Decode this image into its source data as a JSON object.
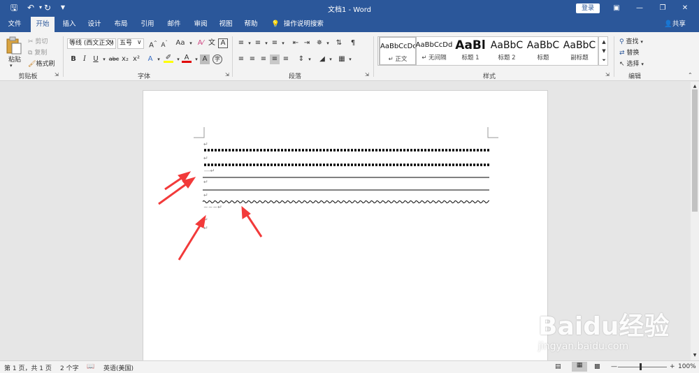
{
  "titlebar": {
    "doc_title": "文档1 - Word",
    "login_label": "登录",
    "quick_access": [
      "save-icon",
      "undo-icon",
      "redo-icon",
      "customize-icon"
    ]
  },
  "tabs": [
    "文件",
    "开始",
    "插入",
    "设计",
    "布局",
    "引用",
    "邮件",
    "审阅",
    "视图",
    "帮助"
  ],
  "active_tab": "开始",
  "tell_me": "操作说明搜索",
  "share_label": "共享",
  "clipboard": {
    "paste": "粘贴",
    "cut": "剪切",
    "copy": "复制",
    "format_painter": "格式刷",
    "group_label": "剪贴板"
  },
  "font": {
    "font_name": "等线 (西文正文)",
    "font_size": "五号",
    "change_case": "Aa",
    "bold": "B",
    "italic": "I",
    "underline": "U",
    "strikethrough": "abc",
    "subscript": "x₂",
    "superscript": "x²",
    "group_label": "字体"
  },
  "paragraph": {
    "group_label": "段落"
  },
  "styles": {
    "items": [
      {
        "preview": "AaBbCcDd",
        "label": "↵ 正文"
      },
      {
        "preview": "AaBbCcDd",
        "label": "↵ 无间隔"
      },
      {
        "preview": "AaBl",
        "label": "标题 1"
      },
      {
        "preview": "AaBbC",
        "label": "标题 2"
      },
      {
        "preview": "AaBbC",
        "label": "标题"
      },
      {
        "preview": "AaBbC",
        "label": "副标题"
      }
    ],
    "group_label": "样式"
  },
  "editing": {
    "find": "查找",
    "replace": "替换",
    "select": "选择",
    "group_label": "编辑"
  },
  "document": {
    "paragraph_mark": "↵",
    "dash_text": "---",
    "tilde_text": "~~~"
  },
  "statusbar": {
    "page_info": "第 1 页，共 1 页",
    "word_count": "2 个字",
    "language": "英语(美国)",
    "zoom": "100%"
  },
  "watermark": {
    "title": "Baidu经验",
    "url": "jingyan.baidu.com"
  },
  "colors": {
    "accent": "#2b579a",
    "arrow": "#f23a3a",
    "highlight": "#ffff00",
    "font_color": "#e00000"
  }
}
